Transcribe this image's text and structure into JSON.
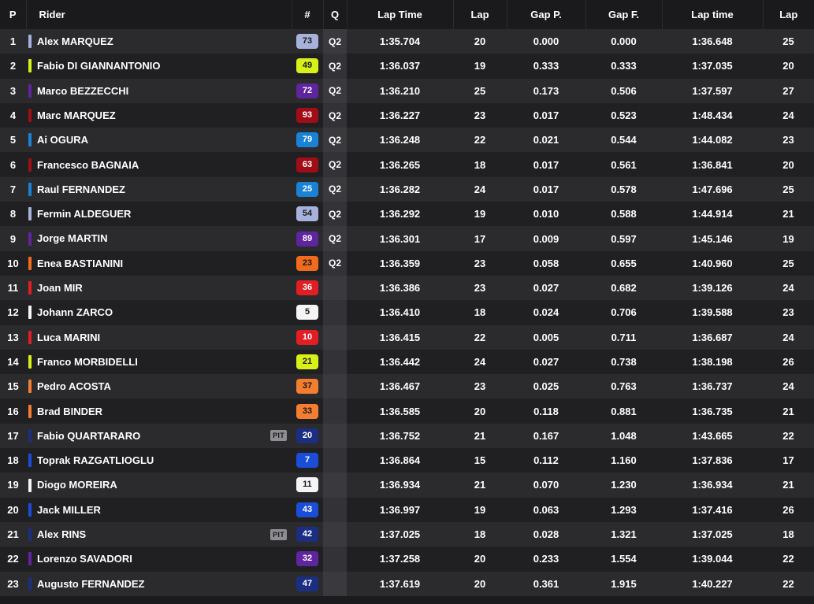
{
  "headers": {
    "pos": "P",
    "rider": "Rider",
    "number": "#",
    "q": "Q",
    "lap_time": "Lap Time",
    "lap": "Lap",
    "gap_p": "Gap P.",
    "gap_f": "Gap F.",
    "lap_time2": "Lap time",
    "lap2": "Lap"
  },
  "pit_label": "PIT",
  "rows": [
    {
      "pos": "1",
      "rider": "Alex MARQUEZ",
      "number": "73",
      "team_color": "#a7b2dc",
      "num_bg": "#a7b2dc",
      "num_fg": "#1a1a1a",
      "q": "Q2",
      "pit": false,
      "lap_time": "1:35.704",
      "lap": "20",
      "gap_p": "0.000",
      "gap_f": "0.000",
      "lap_time2": "1:36.648",
      "lap2": "25"
    },
    {
      "pos": "2",
      "rider": "Fabio DI GIANNANTONIO",
      "number": "49",
      "team_color": "#d8f019",
      "num_bg": "#d8f019",
      "num_fg": "#1a1a1a",
      "q": "Q2",
      "pit": false,
      "lap_time": "1:36.037",
      "lap": "19",
      "gap_p": "0.333",
      "gap_f": "0.333",
      "lap_time2": "1:37.035",
      "lap2": "20"
    },
    {
      "pos": "3",
      "rider": "Marco BEZZECCHI",
      "number": "72",
      "team_color": "#5f259f",
      "num_bg": "#5f259f",
      "num_fg": "#ffffff",
      "q": "Q2",
      "pit": false,
      "lap_time": "1:36.210",
      "lap": "25",
      "gap_p": "0.173",
      "gap_f": "0.506",
      "lap_time2": "1:37.597",
      "lap2": "27"
    },
    {
      "pos": "4",
      "rider": "Marc MARQUEZ",
      "number": "93",
      "team_color": "#a10d17",
      "num_bg": "#a10d17",
      "num_fg": "#ffffff",
      "q": "Q2",
      "pit": false,
      "lap_time": "1:36.227",
      "lap": "23",
      "gap_p": "0.017",
      "gap_f": "0.523",
      "lap_time2": "1:48.434",
      "lap2": "24"
    },
    {
      "pos": "5",
      "rider": "Ai OGURA",
      "number": "79",
      "team_color": "#1a82d6",
      "num_bg": "#1a82d6",
      "num_fg": "#ffffff",
      "q": "Q2",
      "pit": false,
      "lap_time": "1:36.248",
      "lap": "22",
      "gap_p": "0.021",
      "gap_f": "0.544",
      "lap_time2": "1:44.082",
      "lap2": "23"
    },
    {
      "pos": "6",
      "rider": "Francesco BAGNAIA",
      "number": "63",
      "team_color": "#a10d17",
      "num_bg": "#a10d17",
      "num_fg": "#ffffff",
      "q": "Q2",
      "pit": false,
      "lap_time": "1:36.265",
      "lap": "18",
      "gap_p": "0.017",
      "gap_f": "0.561",
      "lap_time2": "1:36.841",
      "lap2": "20"
    },
    {
      "pos": "7",
      "rider": "Raul FERNANDEZ",
      "number": "25",
      "team_color": "#1a82d6",
      "num_bg": "#1a82d6",
      "num_fg": "#ffffff",
      "q": "Q2",
      "pit": false,
      "lap_time": "1:36.282",
      "lap": "24",
      "gap_p": "0.017",
      "gap_f": "0.578",
      "lap_time2": "1:47.696",
      "lap2": "25"
    },
    {
      "pos": "8",
      "rider": "Fermin ALDEGUER",
      "number": "54",
      "team_color": "#a7b2dc",
      "num_bg": "#a7b2dc",
      "num_fg": "#1a1a1a",
      "q": "Q2",
      "pit": false,
      "lap_time": "1:36.292",
      "lap": "19",
      "gap_p": "0.010",
      "gap_f": "0.588",
      "lap_time2": "1:44.914",
      "lap2": "21"
    },
    {
      "pos": "9",
      "rider": "Jorge MARTIN",
      "number": "89",
      "team_color": "#5f259f",
      "num_bg": "#5f259f",
      "num_fg": "#ffffff",
      "q": "Q2",
      "pit": false,
      "lap_time": "1:36.301",
      "lap": "17",
      "gap_p": "0.009",
      "gap_f": "0.597",
      "lap_time2": "1:45.146",
      "lap2": "19"
    },
    {
      "pos": "10",
      "rider": "Enea BASTIANINI",
      "number": "23",
      "team_color": "#f26b1d",
      "num_bg": "#f26b1d",
      "num_fg": "#1a1a1a",
      "q": "Q2",
      "pit": false,
      "lap_time": "1:36.359",
      "lap": "23",
      "gap_p": "0.058",
      "gap_f": "0.655",
      "lap_time2": "1:40.960",
      "lap2": "25"
    },
    {
      "pos": "11",
      "rider": "Joan MIR",
      "number": "36",
      "team_color": "#e01e23",
      "num_bg": "#e01e23",
      "num_fg": "#ffffff",
      "q": "",
      "pit": false,
      "lap_time": "1:36.386",
      "lap": "23",
      "gap_p": "0.027",
      "gap_f": "0.682",
      "lap_time2": "1:39.126",
      "lap2": "24"
    },
    {
      "pos": "12",
      "rider": "Johann ZARCO",
      "number": "5",
      "team_color": "#f4f4f4",
      "num_bg": "#f4f4f4",
      "num_fg": "#1a1a1a",
      "q": "",
      "pit": false,
      "lap_time": "1:36.410",
      "lap": "18",
      "gap_p": "0.024",
      "gap_f": "0.706",
      "lap_time2": "1:39.588",
      "lap2": "23"
    },
    {
      "pos": "13",
      "rider": "Luca MARINI",
      "number": "10",
      "team_color": "#e01e23",
      "num_bg": "#e01e23",
      "num_fg": "#ffffff",
      "q": "",
      "pit": false,
      "lap_time": "1:36.415",
      "lap": "22",
      "gap_p": "0.005",
      "gap_f": "0.711",
      "lap_time2": "1:36.687",
      "lap2": "24"
    },
    {
      "pos": "14",
      "rider": "Franco MORBIDELLI",
      "number": "21",
      "team_color": "#d8f019",
      "num_bg": "#d8f019",
      "num_fg": "#1a1a1a",
      "q": "",
      "pit": false,
      "lap_time": "1:36.442",
      "lap": "24",
      "gap_p": "0.027",
      "gap_f": "0.738",
      "lap_time2": "1:38.198",
      "lap2": "26"
    },
    {
      "pos": "15",
      "rider": "Pedro ACOSTA",
      "number": "37",
      "team_color": "#f47d30",
      "num_bg": "#f47d30",
      "num_fg": "#1a1a1a",
      "q": "",
      "pit": false,
      "lap_time": "1:36.467",
      "lap": "23",
      "gap_p": "0.025",
      "gap_f": "0.763",
      "lap_time2": "1:36.737",
      "lap2": "24"
    },
    {
      "pos": "16",
      "rider": "Brad BINDER",
      "number": "33",
      "team_color": "#f47d30",
      "num_bg": "#f47d30",
      "num_fg": "#1a1a1a",
      "q": "",
      "pit": false,
      "lap_time": "1:36.585",
      "lap": "20",
      "gap_p": "0.118",
      "gap_f": "0.881",
      "lap_time2": "1:36.735",
      "lap2": "21"
    },
    {
      "pos": "17",
      "rider": "Fabio QUARTARARO",
      "number": "20",
      "team_color": "#1b2e82",
      "num_bg": "#1b2e82",
      "num_fg": "#ffffff",
      "q": "",
      "pit": true,
      "lap_time": "1:36.752",
      "lap": "21",
      "gap_p": "0.167",
      "gap_f": "1.048",
      "lap_time2": "1:43.665",
      "lap2": "22"
    },
    {
      "pos": "18",
      "rider": "Toprak RAZGATLIOGLU",
      "number": "7",
      "team_color": "#1b4ed8",
      "num_bg": "#1b4ed8",
      "num_fg": "#ffffff",
      "q": "",
      "pit": false,
      "lap_time": "1:36.864",
      "lap": "15",
      "gap_p": "0.112",
      "gap_f": "1.160",
      "lap_time2": "1:37.836",
      "lap2": "17"
    },
    {
      "pos": "19",
      "rider": "Diogo MOREIRA",
      "number": "11",
      "team_color": "#f4f4f4",
      "num_bg": "#f4f4f4",
      "num_fg": "#1a1a1a",
      "q": "",
      "pit": false,
      "lap_time": "1:36.934",
      "lap": "21",
      "gap_p": "0.070",
      "gap_f": "1.230",
      "lap_time2": "1:36.934",
      "lap2": "21"
    },
    {
      "pos": "20",
      "rider": "Jack MILLER",
      "number": "43",
      "team_color": "#1b4ed8",
      "num_bg": "#1b4ed8",
      "num_fg": "#ffffff",
      "q": "",
      "pit": false,
      "lap_time": "1:36.997",
      "lap": "19",
      "gap_p": "0.063",
      "gap_f": "1.293",
      "lap_time2": "1:37.416",
      "lap2": "26"
    },
    {
      "pos": "21",
      "rider": "Alex RINS",
      "number": "42",
      "team_color": "#1b2e82",
      "num_bg": "#1b2e82",
      "num_fg": "#ffffff",
      "q": "",
      "pit": true,
      "lap_time": "1:37.025",
      "lap": "18",
      "gap_p": "0.028",
      "gap_f": "1.321",
      "lap_time2": "1:37.025",
      "lap2": "18"
    },
    {
      "pos": "22",
      "rider": "Lorenzo SAVADORI",
      "number": "32",
      "team_color": "#5f259f",
      "num_bg": "#5f259f",
      "num_fg": "#ffffff",
      "q": "",
      "pit": false,
      "lap_time": "1:37.258",
      "lap": "20",
      "gap_p": "0.233",
      "gap_f": "1.554",
      "lap_time2": "1:39.044",
      "lap2": "22"
    },
    {
      "pos": "23",
      "rider": "Augusto FERNANDEZ",
      "number": "47",
      "team_color": "#1b2e82",
      "num_bg": "#1b2e82",
      "num_fg": "#ffffff",
      "q": "",
      "pit": false,
      "lap_time": "1:37.619",
      "lap": "20",
      "gap_p": "0.361",
      "gap_f": "1.915",
      "lap_time2": "1:40.227",
      "lap2": "22"
    }
  ]
}
